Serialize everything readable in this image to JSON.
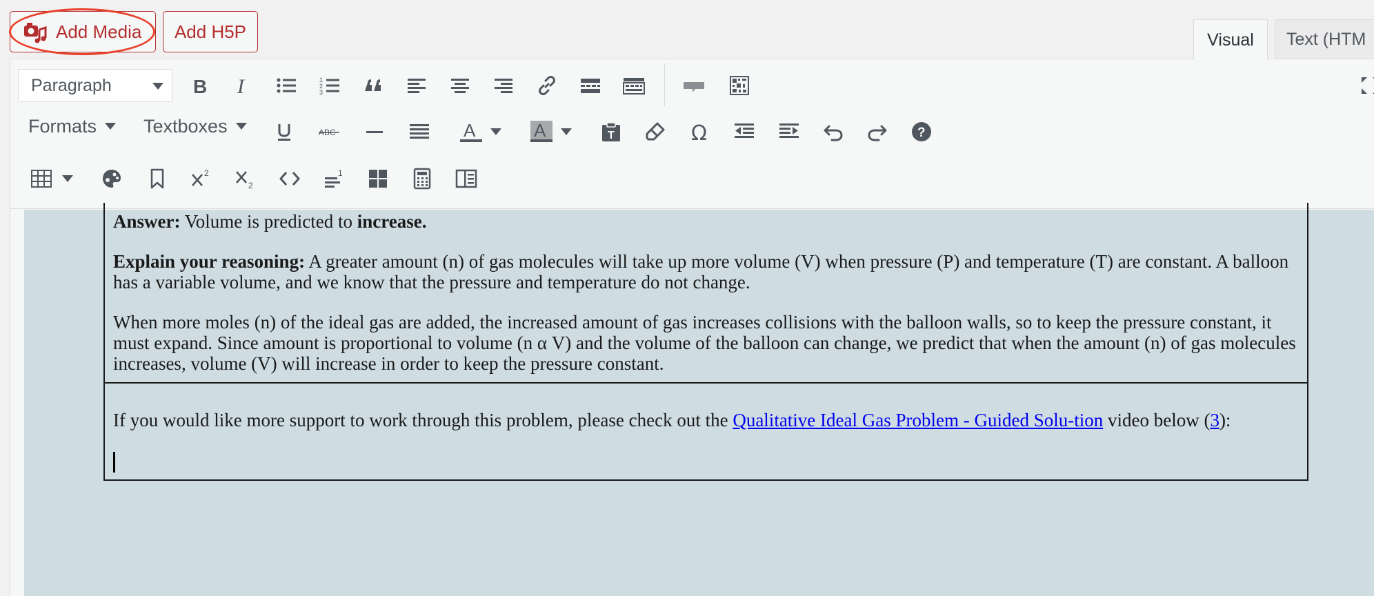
{
  "media_buttons": {
    "add_media": "Add Media",
    "add_h5p": "Add H5P"
  },
  "tabs": {
    "visual": "Visual",
    "text": "Text (HTM"
  },
  "toolbar": {
    "paragraph_select": "Paragraph",
    "formats_label": "Formats",
    "textboxes_label": "Textboxes",
    "row1_icons": [
      "bold-icon",
      "italic-icon",
      "bulleted-list-icon",
      "numbered-list-icon",
      "blockquote-icon",
      "align-left-icon",
      "align-center-icon",
      "align-right-icon",
      "link-icon",
      "read-more-icon",
      "toolbar-toggle-icon",
      "comment-icon",
      "qr-grid-icon",
      "fullscreen-icon"
    ],
    "row2_icons": [
      "underline-icon",
      "strikethrough-icon",
      "horizontal-rule-icon",
      "justify-icon",
      "text-color-icon",
      "background-color-icon",
      "paste-text-icon",
      "clear-formatting-icon",
      "omega-icon",
      "outdent-icon",
      "indent-icon",
      "undo-icon",
      "redo-icon",
      "help-icon"
    ],
    "row3_icons": [
      "table-icon",
      "palette-icon",
      "bookmark-icon",
      "superscript-icon",
      "subscript-icon",
      "code-icon",
      "footnote-icon",
      "blocks-icon",
      "calculator-icon",
      "columns-icon"
    ]
  },
  "content": {
    "answer_label": "Answer:",
    "answer_text": " Volume is predicted to ",
    "answer_bold": "increase",
    "answer_end": ".",
    "reasoning_label": "Explain your reasoning:",
    "reasoning_text": " A greater amount (n) of gas molecules will take up more volume (V) when pressure (P) and temperature (T) are constant. A balloon has a variable volume, and we know that the pressure and temperature do not change.",
    "paragraph2": "When more moles (n) of the ideal gas are added, the increased amount of gas increases collisions with the balloon walls, so to keep the pressure constant, it must expand. Since amount is proportional to volume (n α V) and the volume of the balloon can change, we predict that when the amount (n) of gas molecules increases, volume (V) will increase in order to keep the pressure constant.",
    "support_before": "If you would like more support to work through this problem, please check out the ",
    "support_link": "Qualitative Ideal Gas Problem - Guided Solu-tion",
    "support_after": " video below (",
    "support_ref": "3",
    "support_end": "):"
  },
  "colors": {
    "accent_red": "#b32d2e",
    "highlight_oval": "#e8402a",
    "content_bg": "#cfdde3",
    "link": "#0000ee"
  }
}
